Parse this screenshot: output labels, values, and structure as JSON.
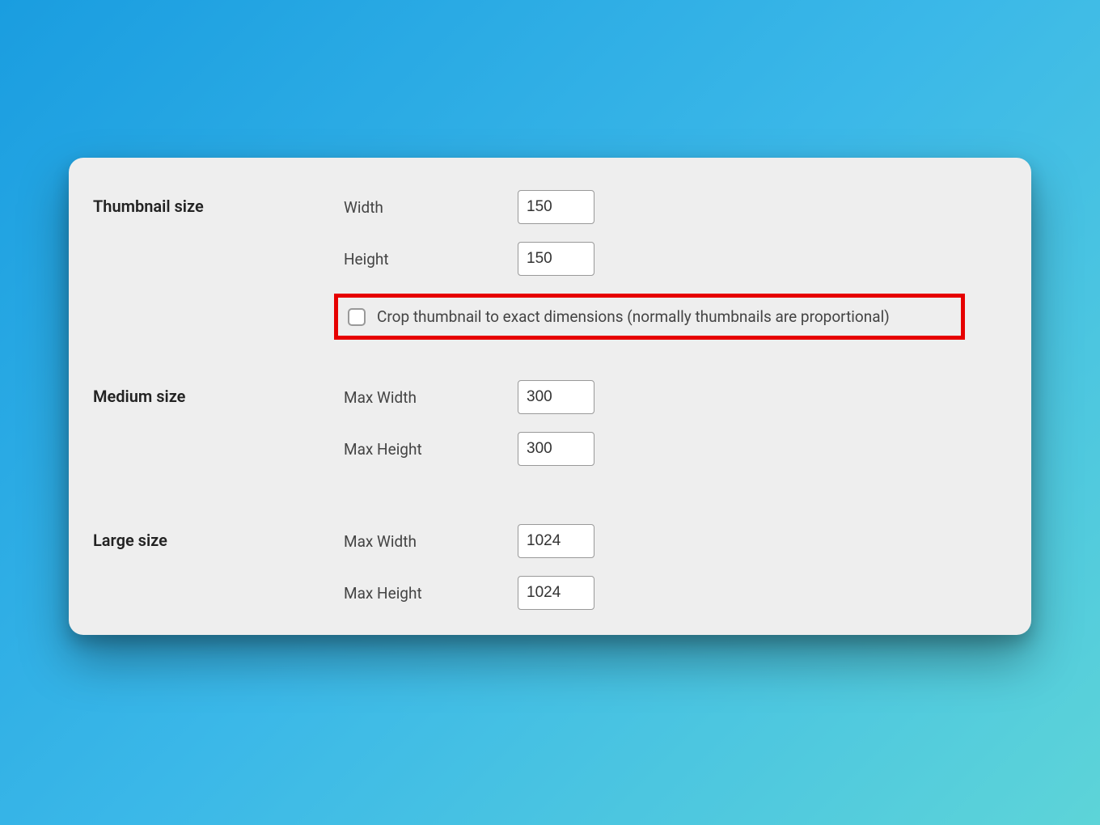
{
  "thumbnail": {
    "section_label": "Thumbnail size",
    "width_label": "Width",
    "width_value": "150",
    "height_label": "Height",
    "height_value": "150",
    "crop_label": "Crop thumbnail to exact dimensions (normally thumbnails are proportional)",
    "crop_checked": false
  },
  "medium": {
    "section_label": "Medium size",
    "max_width_label": "Max Width",
    "max_width_value": "300",
    "max_height_label": "Max Height",
    "max_height_value": "300"
  },
  "large": {
    "section_label": "Large size",
    "max_width_label": "Max Width",
    "max_width_value": "1024",
    "max_height_label": "Max Height",
    "max_height_value": "1024"
  }
}
